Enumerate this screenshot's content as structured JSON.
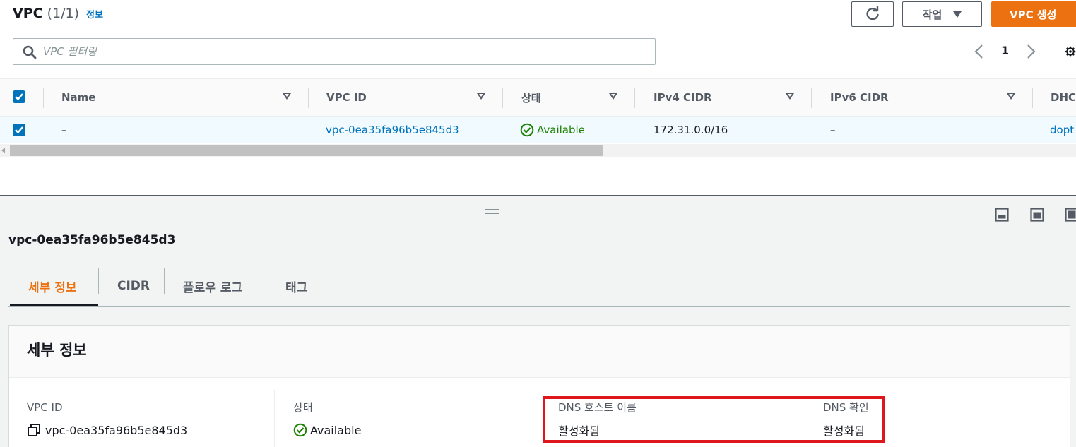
{
  "header": {
    "title": "VPC",
    "count": "(1/1)",
    "info_link": "정보",
    "actions_label": "작업",
    "create_label": "VPC 생성"
  },
  "filter": {
    "placeholder": "VPC 필터링"
  },
  "pagination": {
    "current_page": "1"
  },
  "table": {
    "columns": [
      "Name",
      "VPC ID",
      "상태",
      "IPv4 CIDR",
      "IPv6 CIDR",
      "DHC"
    ],
    "rows": [
      {
        "name": "–",
        "vpc_id": "vpc-0ea35fa96b5e845d3",
        "state": "Available",
        "ipv4_cidr": "172.31.0.0/16",
        "ipv6_cidr": "–",
        "dhcp": "dopt"
      }
    ]
  },
  "details": {
    "title": "vpc-0ea35fa96b5e845d3",
    "tabs": [
      "세부 정보",
      "CIDR",
      "플로우 로그",
      "태그"
    ],
    "card_title": "세부 정보",
    "fields": [
      {
        "label": "VPC ID",
        "value": "vpc-0ea35fa96b5e845d3"
      },
      {
        "label": "상태",
        "value": "Available"
      },
      {
        "label": "DNS 호스트 이름",
        "value": "활성화됨"
      },
      {
        "label": "DNS 확인",
        "value": "활성화됨"
      }
    ]
  },
  "colors": {
    "primary_orange": "#ec7211",
    "link_blue": "#0073bb",
    "status_green": "#1d8102",
    "highlight_red": "#e0161d"
  },
  "icons": [
    "search-icon",
    "refresh-icon",
    "chevron-left-icon",
    "chevron-right-icon",
    "gear-icon",
    "copy-icon",
    "status-check-icon",
    "panel-bottom-icon",
    "panel-side-icon",
    "panel-full-icon"
  ]
}
